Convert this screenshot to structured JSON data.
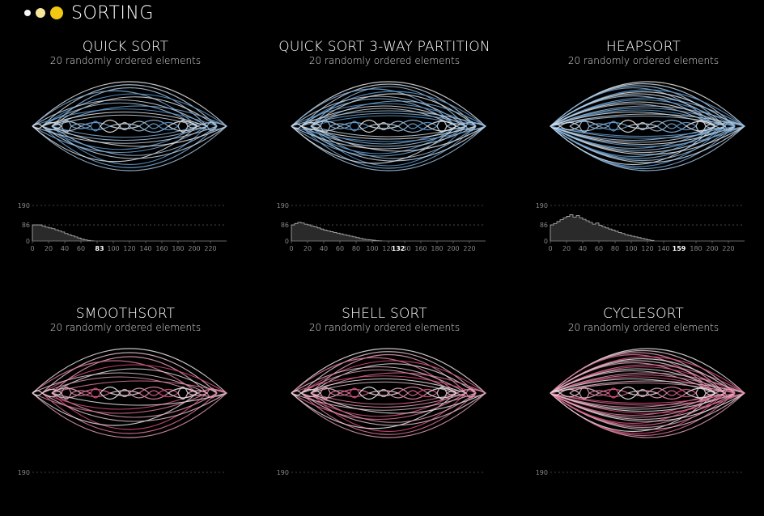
{
  "app": {
    "title": "SORTING",
    "dots": [
      "#f5f5f5",
      "#f7e79a",
      "#f3c812"
    ]
  },
  "panels": [
    {
      "title": "QUICK SORT",
      "subtitle": "20 randomly ordered elements",
      "palette": "blue",
      "arcs_depth": 4,
      "chart": {
        "y_ticks": [
          "190",
          "86",
          "0"
        ],
        "x_ticks": [
          "0",
          "20",
          "40",
          "60",
          "80",
          "100",
          "120",
          "140",
          "160",
          "180",
          "200",
          "220"
        ],
        "marker": "83",
        "marker_x": 83,
        "values": [
          86,
          86,
          86,
          80,
          74,
          70,
          66,
          60,
          54,
          48,
          40,
          34,
          28,
          22,
          16,
          10,
          6,
          3,
          1
        ]
      }
    },
    {
      "title": "QUICK SORT 3-WAY PARTITION",
      "subtitle": "20 randomly ordered elements",
      "palette": "blue",
      "arcs_depth": 5,
      "chart": {
        "y_ticks": [
          "190",
          "86",
          "0"
        ],
        "x_ticks": [
          "0",
          "20",
          "40",
          "60",
          "80",
          "100",
          "120",
          "140",
          "160",
          "180",
          "200",
          "220"
        ],
        "marker": "132",
        "marker_x": 132,
        "values": [
          86,
          94,
          100,
          96,
          90,
          86,
          80,
          76,
          70,
          64,
          58,
          54,
          50,
          46,
          42,
          38,
          34,
          30,
          26,
          22,
          18,
          14,
          10,
          8,
          6,
          4,
          2,
          1
        ]
      }
    },
    {
      "title": "HEAPSORT",
      "subtitle": "20 randomly ordered elements",
      "palette": "blue",
      "arcs_depth": 6,
      "chart": {
        "y_ticks": [
          "190",
          "86",
          "0"
        ],
        "x_ticks": [
          "0",
          "20",
          "40",
          "60",
          "80",
          "100",
          "120",
          "140",
          "160",
          "180",
          "200",
          "220"
        ],
        "marker": "159",
        "marker_x": 159,
        "values": [
          86,
          94,
          104,
          114,
          124,
          132,
          140,
          128,
          136,
          124,
          116,
          108,
          100,
          90,
          96,
          84,
          76,
          70,
          64,
          58,
          52,
          46,
          40,
          34,
          30,
          26,
          22,
          18,
          14,
          10,
          6,
          3
        ]
      }
    },
    {
      "title": "SMOOTHSORT",
      "subtitle": "20 randomly ordered elements",
      "palette": "pink",
      "arcs_depth": 3,
      "chart": {
        "y_ticks": [
          "190"
        ]
      }
    },
    {
      "title": "SHELL SORT",
      "subtitle": "20 randomly ordered elements",
      "palette": "pink",
      "arcs_depth": 4,
      "chart": {
        "y_ticks": [
          "190"
        ]
      }
    },
    {
      "title": "CYCLESORT",
      "subtitle": "20 randomly ordered elements",
      "palette": "pink",
      "arcs_depth": 6,
      "chart": {
        "y_ticks": [
          "190"
        ]
      }
    }
  ]
}
